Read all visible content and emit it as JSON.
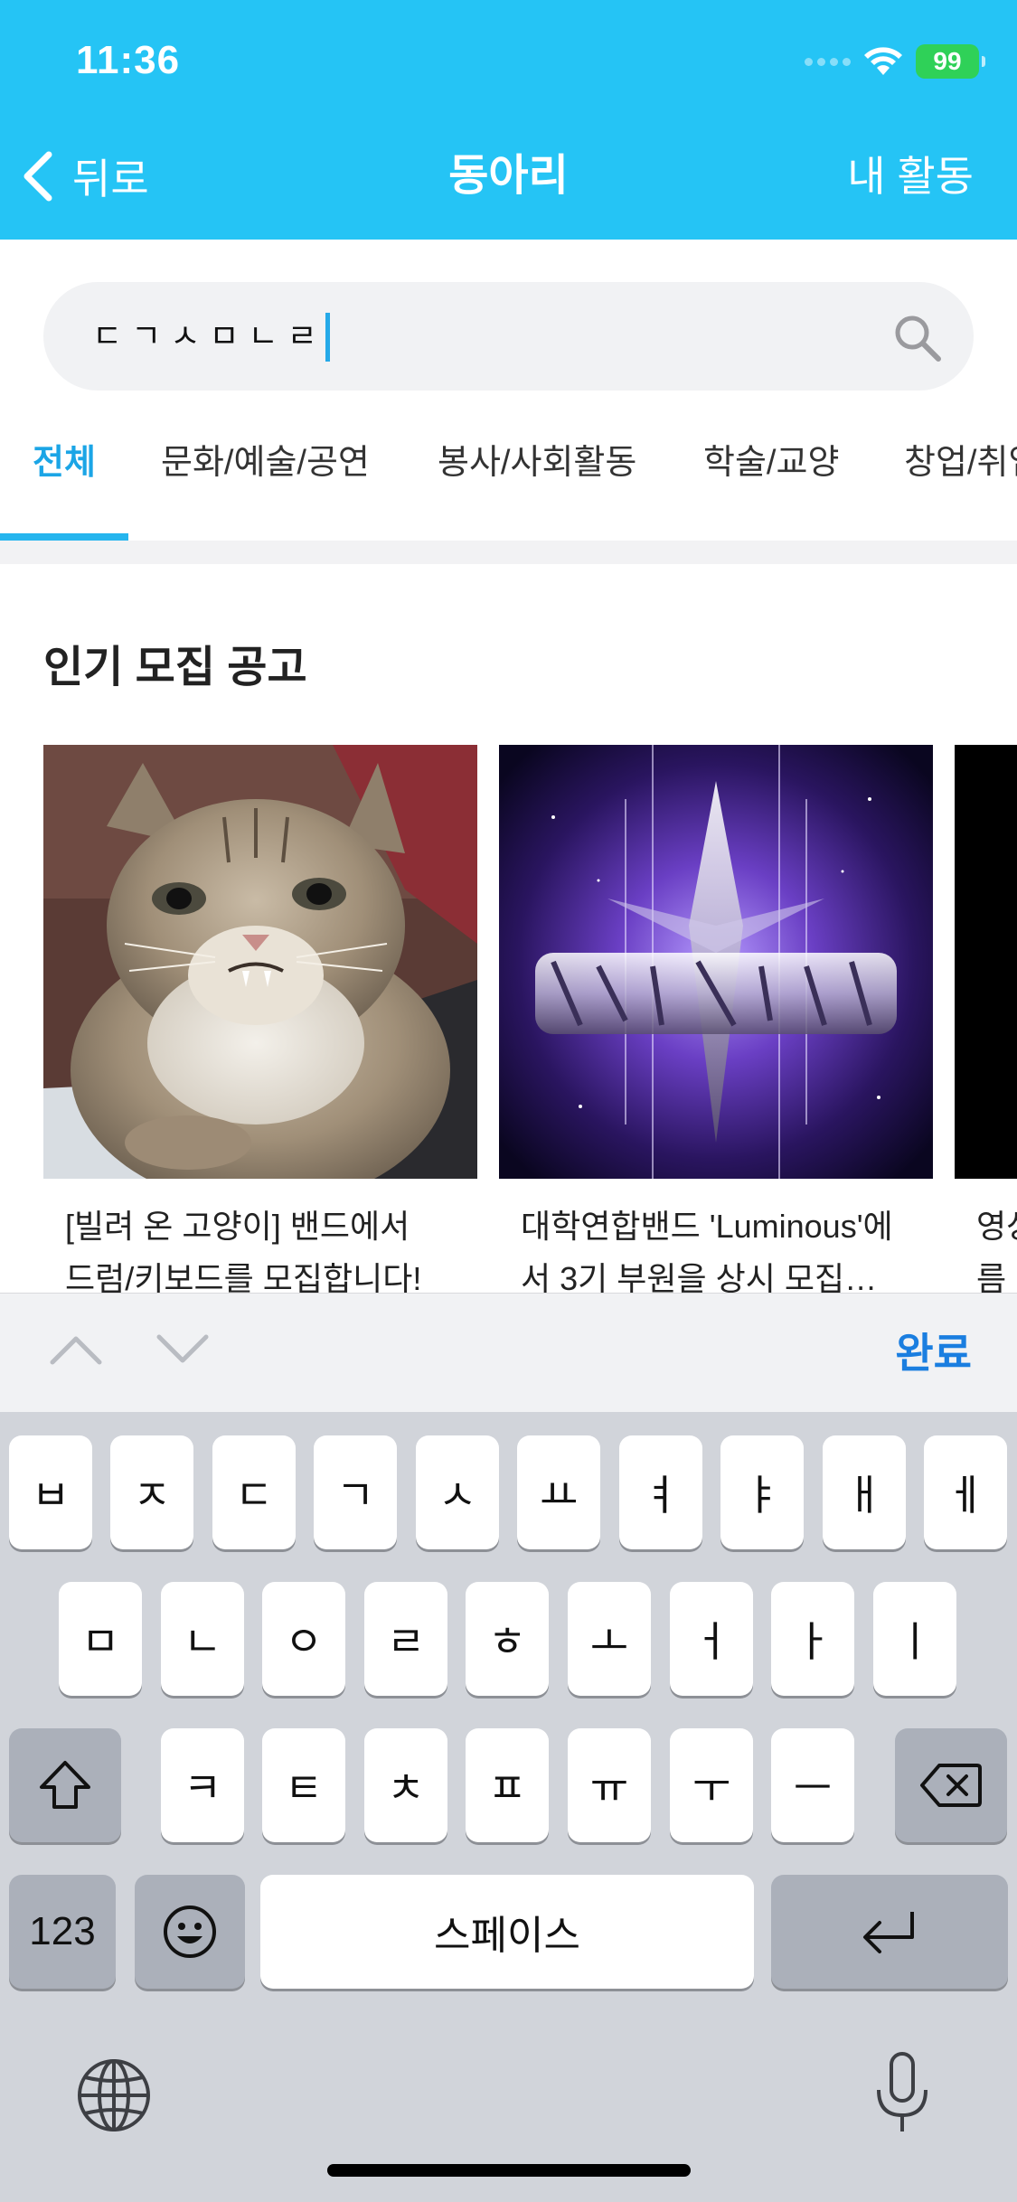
{
  "status": {
    "time": "11:36",
    "battery": "99"
  },
  "nav": {
    "back_label": "뒤로",
    "title": "동아리",
    "right_label": "내 활동"
  },
  "search": {
    "value": "ㄷㄱㅅㅁㄴㄹ"
  },
  "tabs": [
    {
      "label": "전체",
      "active": true
    },
    {
      "label": "문화/예술/공연",
      "active": false
    },
    {
      "label": "봉사/사회활동",
      "active": false
    },
    {
      "label": "학술/교양",
      "active": false
    },
    {
      "label": "창업/취업",
      "active": false
    }
  ],
  "section": {
    "title": "인기 모집 공고"
  },
  "cards": [
    {
      "title_line1": "[빌려 온 고양이] 밴드에서",
      "title_line2": "드럼/키보드를 모집합니다!"
    },
    {
      "title_line1": "대학연합밴드 'Luminous'에",
      "title_line2": "서 3기 부원을 상시 모집…"
    },
    {
      "title_line1": "영상",
      "title_line2": "름"
    }
  ],
  "keyboard": {
    "done_label": "완료",
    "row1": [
      "ㅂ",
      "ㅈ",
      "ㄷ",
      "ㄱ",
      "ㅅ",
      "ㅛ",
      "ㅕ",
      "ㅑ",
      "ㅐ",
      "ㅔ"
    ],
    "row2": [
      "ㅁ",
      "ㄴ",
      "ㅇ",
      "ㄹ",
      "ㅎ",
      "ㅗ",
      "ㅓ",
      "ㅏ",
      "ㅣ"
    ],
    "row3": [
      "ㅋ",
      "ㅌ",
      "ㅊ",
      "ㅍ",
      "ㅠ",
      "ㅜ",
      "ㅡ"
    ],
    "numbers_label": "123",
    "space_label": "스페이스",
    "icons": [
      "shift-icon",
      "delete-icon",
      "emoji-icon",
      "return-icon",
      "globe-icon",
      "microphone-icon"
    ]
  },
  "colors": {
    "header": "#25C4F5",
    "accent": "#1BA5E6",
    "done": "#1A7EE0"
  }
}
